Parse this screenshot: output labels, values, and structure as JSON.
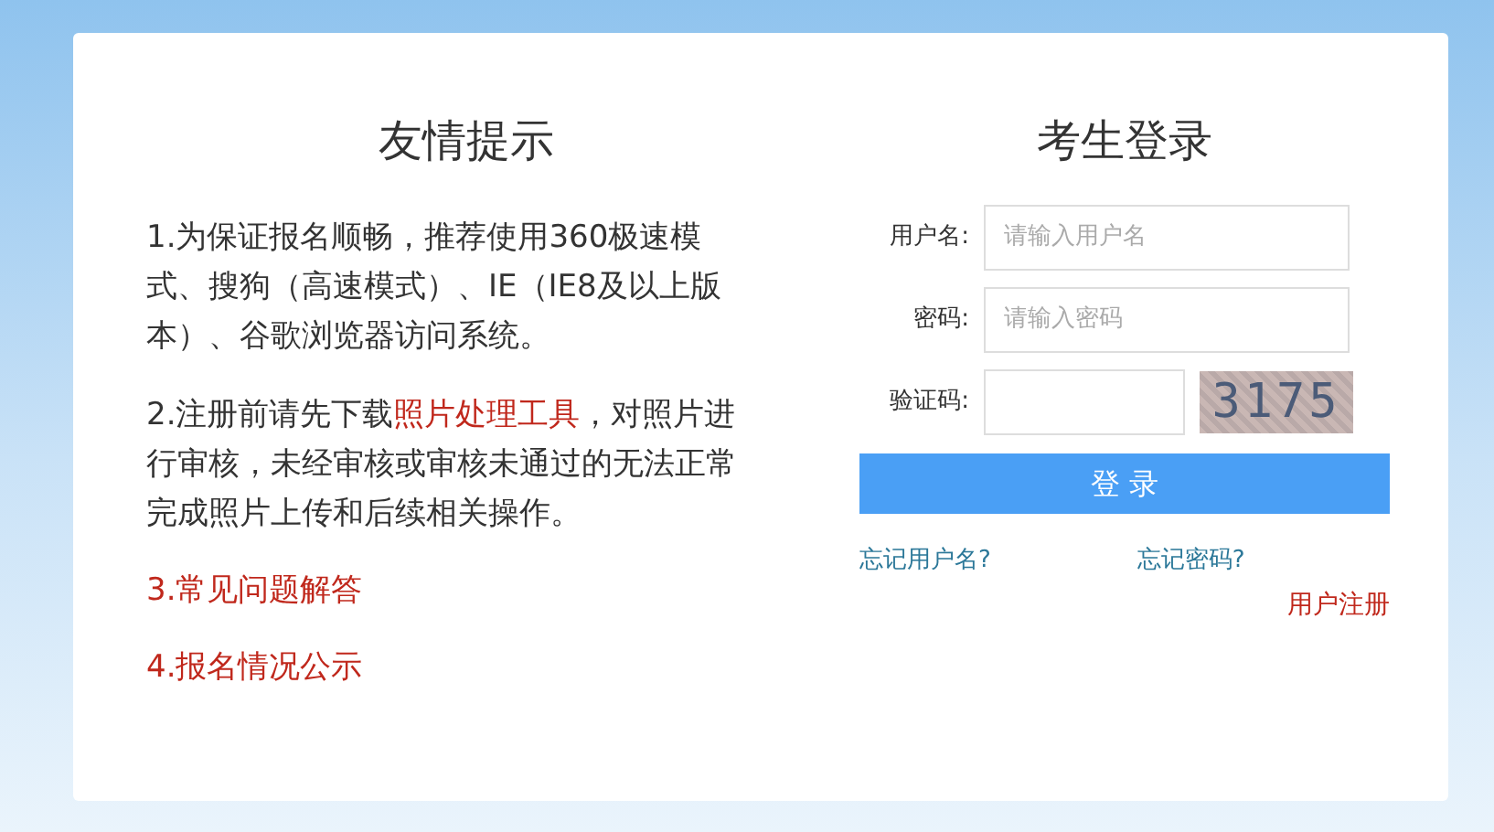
{
  "notice": {
    "title": "友情提示",
    "tip_1": "1.为保证报名顺畅，推荐使用360极速模式、搜狗（高速模式）、IE（IE8及以上版本）、谷歌浏览器访问系统。",
    "tip_2": {
      "before": "2.注册前请先下载",
      "link": "照片处理工具",
      "after": "，对照片进行审核，未经审核或审核未通过的无法正常完成照片上传和后续相关操作。"
    },
    "links": [
      "3.常见问题解答",
      "4.报名情况公示"
    ]
  },
  "login": {
    "title": "考生登录",
    "fields": [
      {
        "kind": "text",
        "label": "用户名:",
        "placeholder": "请输入用户名"
      },
      {
        "kind": "password",
        "label": "密码:",
        "placeholder": "请输入密码"
      },
      {
        "kind": "captcha",
        "label": "验证码:",
        "captcha": "3175"
      }
    ],
    "submit": "登 录",
    "forgot_username": "忘记用户名?",
    "forgot_password": "忘记密码?",
    "register": "用户注册"
  }
}
